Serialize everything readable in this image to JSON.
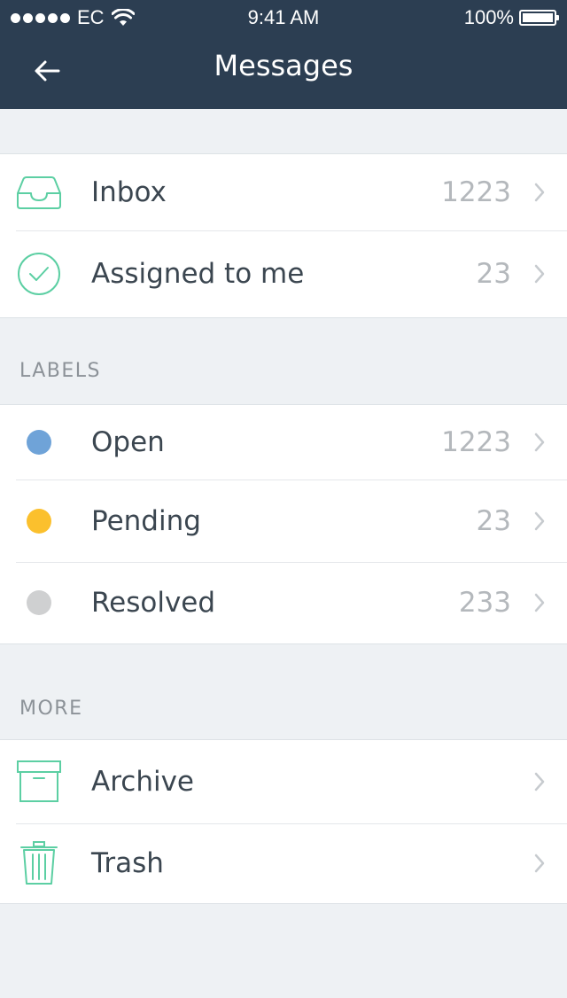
{
  "status_bar": {
    "carrier": "EC",
    "time": "9:41 AM",
    "battery": "100%",
    "battery_level": 1.0
  },
  "nav": {
    "back_icon": "arrow-left-icon",
    "title": "Messages"
  },
  "colors": {
    "header_bg": "#2c3e52",
    "accent_green": "#5ccfa3",
    "label_open": "#6fa3d8",
    "label_pending": "#fbc02d",
    "label_resolved": "#cfd0d1"
  },
  "primary": [
    {
      "icon": "inbox-tray-icon",
      "label": "Inbox",
      "count": "1223"
    },
    {
      "icon": "check-circle-icon",
      "label": "Assigned to me",
      "count": "23"
    }
  ],
  "labels": {
    "header": "LABELS",
    "items": [
      {
        "icon": "blue-dot-icon",
        "label": "Open",
        "count": "1223"
      },
      {
        "icon": "yellow-dot-icon",
        "label": "Pending",
        "count": "23"
      },
      {
        "icon": "gray-dot-icon",
        "label": "Resolved",
        "count": "233"
      }
    ]
  },
  "more": {
    "header": "MORE",
    "items": [
      {
        "icon": "archive-box-icon",
        "label": "Archive"
      },
      {
        "icon": "trash-icon",
        "label": "Trash"
      }
    ]
  }
}
